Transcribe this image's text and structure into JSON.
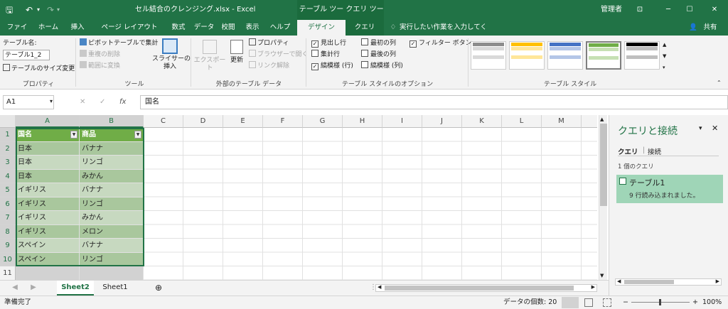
{
  "titlebar": {
    "filename_title": "セル結合のクレンジング.xlsx  -  Excel",
    "ctx_table_tools": "テーブル ツール",
    "ctx_query_tools": "クエリ ツール",
    "user": "管理者",
    "minimize": "─",
    "restore": "☐",
    "close": "✕"
  },
  "tabs": [
    "ファイル",
    "ホーム",
    "挿入",
    "ページ レイアウト",
    "数式",
    "データ",
    "校閲",
    "表示",
    "ヘルプ",
    "デザイン",
    "クエリ"
  ],
  "tell_me": "実行したい作業を入力してください",
  "share": "共有",
  "ribbon": {
    "properties": {
      "label": "プロパティ",
      "table_name_label": "テーブル名:",
      "table_name_value": "テーブル1_2",
      "resize": "テーブルのサイズ変更"
    },
    "tools": {
      "label": "ツール",
      "pivot": "ピボットテーブルで集計",
      "remove_dup": "重複の削除",
      "convert_range": "範囲に変換",
      "slicer": "スライサーの\n挿入"
    },
    "external": {
      "label": "外部のテーブル データ",
      "export": "エクスポート",
      "refresh": "更新",
      "properties": "プロパティ",
      "open_browser": "ブラウザーで開く",
      "unlink": "リンク解除"
    },
    "style_options": {
      "label": "テーブル スタイルのオプション",
      "header_row": "見出し行",
      "total_row": "集計行",
      "banded_rows": "縞模様 (行)",
      "first_col": "最初の列",
      "last_col": "最後の列",
      "banded_cols": "縞模様 (列)",
      "filter_button": "フィルター ボタン"
    },
    "styles": {
      "label": "テーブル スタイル"
    }
  },
  "formula_bar": {
    "name_box": "A1",
    "content": "国名",
    "fx": "fx"
  },
  "grid": {
    "columns": [
      "A",
      "B",
      "C",
      "D",
      "E",
      "F",
      "G",
      "H",
      "I",
      "J",
      "K",
      "L",
      "M"
    ],
    "rows": [
      "1",
      "2",
      "3",
      "4",
      "5",
      "6",
      "7",
      "8",
      "9",
      "10",
      "11"
    ],
    "table_header": [
      "国名",
      "商品"
    ],
    "table_rows": [
      [
        "日本",
        "バナナ"
      ],
      [
        "日本",
        "リンゴ"
      ],
      [
        "日本",
        "みかん"
      ],
      [
        "イギリス",
        "バナナ"
      ],
      [
        "イギリス",
        "リンゴ"
      ],
      [
        "イギリス",
        "みかん"
      ],
      [
        "イギリス",
        "メロン"
      ],
      [
        "スペイン",
        "バナナ"
      ],
      [
        "スペイン",
        "リンゴ"
      ]
    ]
  },
  "sheets": {
    "tab1": "Sheet2",
    "tab2": "Sheet1",
    "add": "⊕"
  },
  "status": {
    "ready": "準備完了",
    "count": "データの個数: 20",
    "zoom": "100%"
  },
  "query_pane": {
    "title": "クエリと接続",
    "tab_queries": "クエリ",
    "tab_connections": "接続",
    "count": "1 個のクエリ",
    "item_name": "テーブル1",
    "item_status": "9 行読み込まれました。"
  }
}
